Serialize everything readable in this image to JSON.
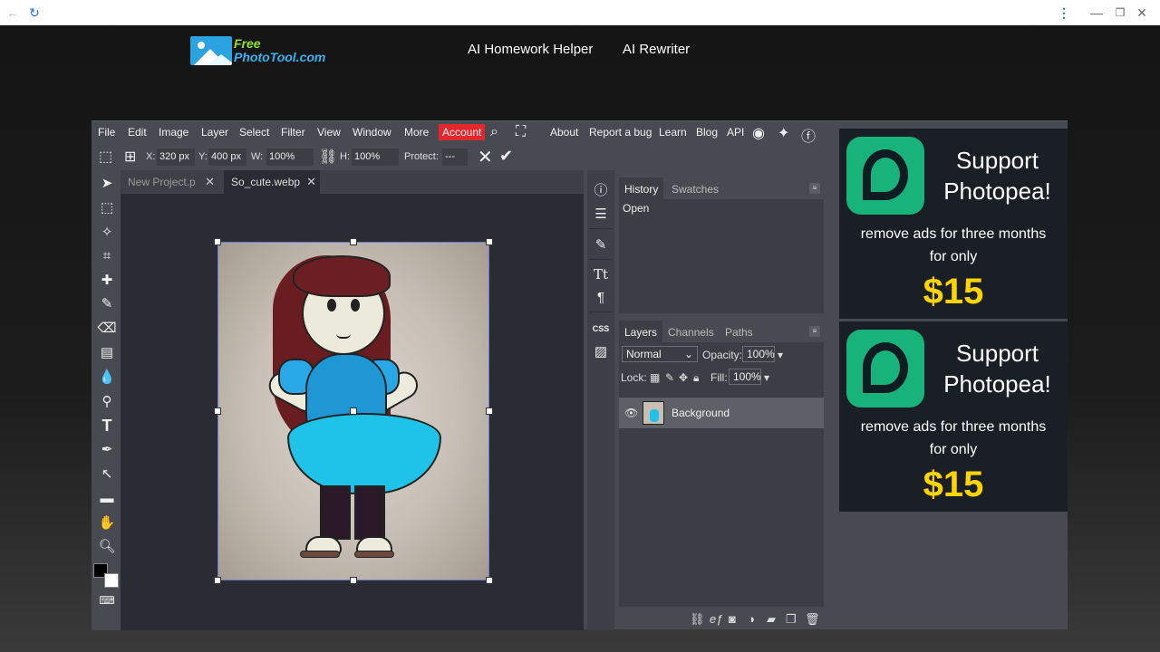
{
  "site": {
    "logo_line1": "Free",
    "logo_line2": "PhotoTool.com",
    "nav": [
      "AI Homework Helper",
      "AI Rewriter"
    ]
  },
  "menu": {
    "items": [
      "File",
      "Edit",
      "Image",
      "Layer",
      "Select",
      "Filter",
      "View",
      "Window",
      "More",
      "Account"
    ],
    "right_items": [
      "About",
      "Report a bug",
      "Learn",
      "Blog",
      "API"
    ]
  },
  "options": {
    "x_label": "X:",
    "x_value": "320 px",
    "y_label": "Y:",
    "y_value": "400 px",
    "w_label": "W:",
    "w_value": "100%",
    "h_label": "H:",
    "h_value": "100%",
    "protect_label": "Protect:",
    "protect_value": "---"
  },
  "documents": {
    "tabs": [
      {
        "label": "New Project.p",
        "active": false
      },
      {
        "label": "So_cute.webp",
        "active": true
      }
    ]
  },
  "history_panel": {
    "tabs": [
      "History",
      "Swatches"
    ],
    "entries": [
      "Open"
    ]
  },
  "layers_panel": {
    "tabs": [
      "Layers",
      "Channels",
      "Paths"
    ],
    "blend_mode": "Normal",
    "opacity_label": "Opacity:",
    "opacity_value": "100%",
    "lock_label": "Lock:",
    "fill_label": "Fill:",
    "fill_value": "100%",
    "layers": [
      {
        "name": "Background",
        "visible": true
      }
    ]
  },
  "ads": [
    {
      "title_line1": "Support",
      "title_line2": "Photopea!",
      "body_line1": "remove ads for three months",
      "body_line2": "for only",
      "price": "$15"
    },
    {
      "title_line1": "Support",
      "title_line2": "Photopea!",
      "body_line1": "remove ads for three months",
      "body_line2": "for only",
      "price": "$15"
    }
  ],
  "colors": {
    "account_button": "#e2272e",
    "ad_price": "#ffd400",
    "ad_logo": "#18b37b",
    "selection_border": "#6a7ad8"
  }
}
